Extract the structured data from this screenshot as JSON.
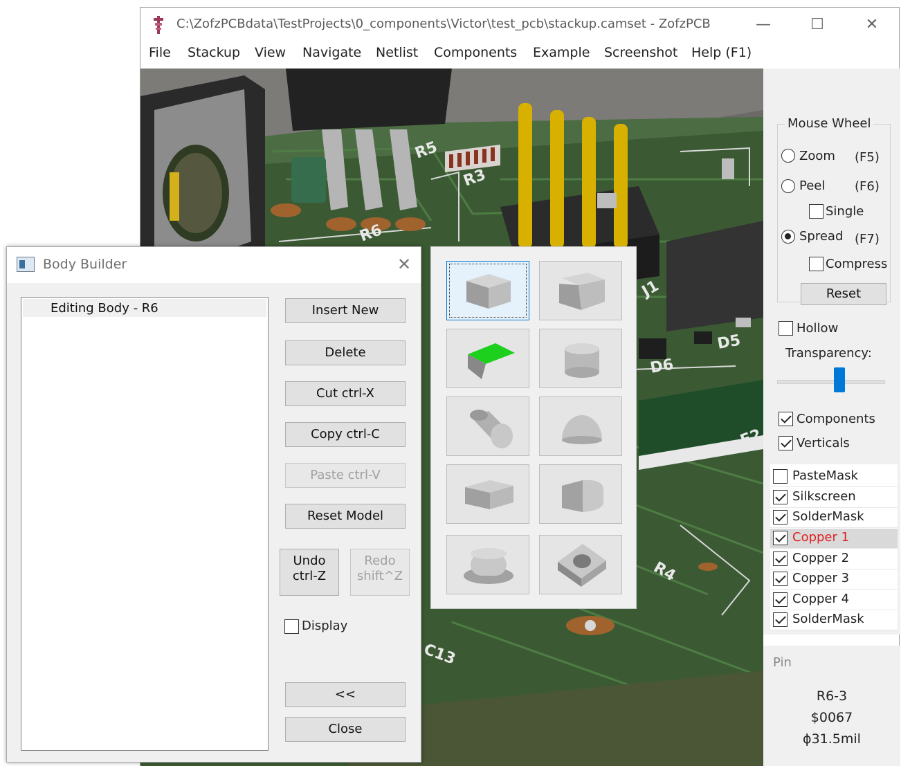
{
  "window": {
    "title": "C:\\ZofzPCBdata\\TestProjects\\0_components\\Victor\\test_pcb\\stackup.camset - ZofzPCB",
    "minimize": "—",
    "maximize": "☐",
    "close": "✕"
  },
  "menu": [
    "File",
    "Stackup",
    "View",
    "Navigate",
    "Netlist",
    "Components",
    "Example",
    "Screenshot",
    "Help (F1)"
  ],
  "viewport": {
    "silkscreen_labels": [
      "R6",
      "R5",
      "R3",
      "R4",
      "C13",
      "D5",
      "D6",
      "F2",
      "J1"
    ]
  },
  "mouse_wheel": {
    "legend": "Mouse Wheel",
    "zoom_label": "Zoom",
    "zoom_key": "(F5)",
    "peel_label": "Peel",
    "peel_key": "(F6)",
    "single_label": "Single",
    "spread_label": "Spread",
    "spread_key": "(F7)",
    "compress_label": "Compress",
    "selected_mode": "Spread",
    "reset_label": "Reset"
  },
  "view_options": {
    "hollow_label": "Hollow",
    "hollow_checked": false,
    "transparency_label": "Transparency:",
    "transparency_value": 0.6,
    "components_label": "Components",
    "components_checked": true,
    "verticals_label": "Verticals",
    "verticals_checked": true
  },
  "layers": [
    {
      "name": "PasteMask",
      "checked": false
    },
    {
      "name": "Silkscreen",
      "checked": true
    },
    {
      "name": "SolderMask",
      "checked": true
    },
    {
      "name": "Copper  1",
      "checked": true,
      "selected": true,
      "color": "#e0201e"
    },
    {
      "name": "Copper  2",
      "checked": true
    },
    {
      "name": "Copper  3",
      "checked": true
    },
    {
      "name": "Copper  4",
      "checked": true
    },
    {
      "name": "SolderMask",
      "checked": true
    }
  ],
  "pin": {
    "title": "Pin",
    "ref": "R6-3",
    "net": "$0067",
    "diameter": "ϕ31.5mil"
  },
  "body_builder": {
    "title": "Body Builder",
    "close": "✕",
    "list_items": [
      "Editing Body - R6"
    ],
    "insert_new": "Insert New",
    "delete": "Delete",
    "cut": "Cut  ctrl-X",
    "copy": "Copy  ctrl-C",
    "paste": "Paste  ctrl-V",
    "reset_model": "Reset Model",
    "undo_line1": "Undo",
    "undo_line2": "ctrl-Z",
    "redo_line1": "Redo",
    "redo_line2": "shift^Z",
    "display_label": "Display",
    "display_checked": false,
    "collapse": "<<",
    "close_button": "Close"
  },
  "shape_palette": {
    "shapes": [
      "box-icon",
      "chamfered-box-icon",
      "bent-plate-icon",
      "vertical-cylinder-icon",
      "horizontal-cylinder-icon",
      "dome-icon",
      "rounded-box-icon",
      "half-cylinder-icon",
      "oval-pad-icon",
      "box-with-hole-icon"
    ],
    "selected_index": 0
  },
  "colors": {
    "pcb_green": "#3c5a34",
    "gold_pin": "#d8b000",
    "accent": "#0078d7",
    "selected_layer_text": "#e0201e"
  }
}
